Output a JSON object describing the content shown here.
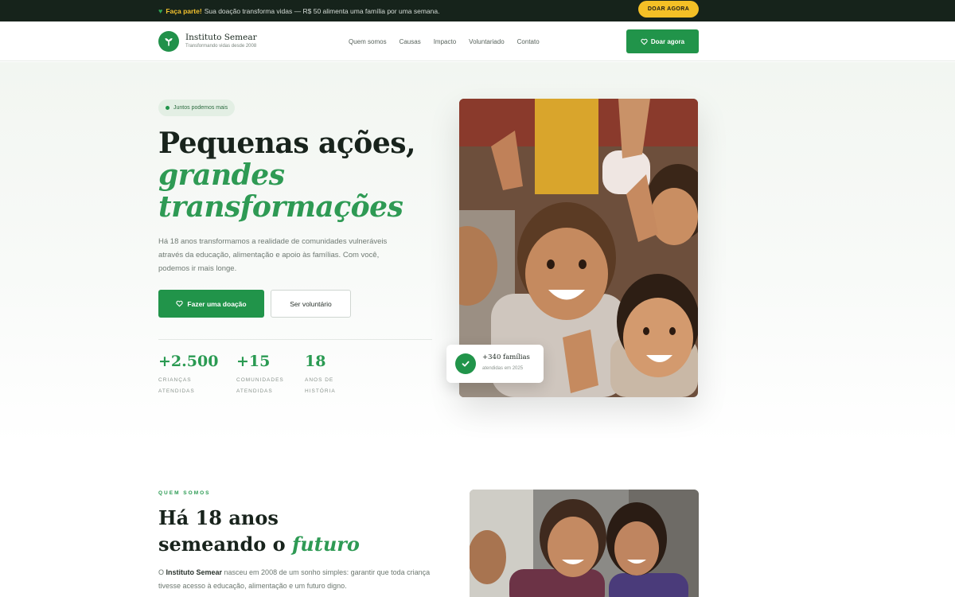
{
  "topbar": {
    "highlight": "Faça parte!",
    "message": "Sua doação transforma vidas — R$ 50 alimenta uma família por uma semana.",
    "donate_label": "DOAR AGORA"
  },
  "header": {
    "org_name": "Instituto Semear",
    "tagline": "Transformando vidas desde 2008",
    "nav": [
      "Quem somos",
      "Causas",
      "Impacto",
      "Voluntariado",
      "Contato"
    ],
    "donate_label": "Doar agora"
  },
  "hero": {
    "badge": "Juntos podemos mais",
    "title_line1": "Pequenas ações,",
    "title_line2": "grandes",
    "title_line3": "transformações",
    "lead": "Há 18 anos transformamos a realidade de comunidades vulneráveis através da educação, alimentação e apoio às famílias. Com você, podemos ir mais longe.",
    "primary_cta": "Fazer uma doação",
    "secondary_cta": "Ser voluntário",
    "stats": [
      {
        "value": "+2.500",
        "label": "CRIANÇAS ATENDIDAS"
      },
      {
        "value": "+15",
        "label": "COMUNIDADES ATENDIDAS"
      },
      {
        "value": "18",
        "label": "ANOS DE HISTÓRIA"
      }
    ],
    "card_title": "+340 famílias",
    "card_sub": "atendidas em 2025"
  },
  "about": {
    "eyebrow": "QUEM SOMOS",
    "title_line1": "Há 18 anos",
    "title_line2_a": "semeando o ",
    "title_line2_b": "futuro",
    "p_prefix": "O ",
    "p_strong": "Instituto Semear",
    "p_rest": " nasceu em 2008 de um sonho simples: garantir que toda criança tivesse acesso à educação, alimentação e um futuro digno."
  },
  "colors": {
    "brand_green": "#21944a",
    "accent_yellow": "#f4c026",
    "topbar_bg": "#16231b"
  }
}
